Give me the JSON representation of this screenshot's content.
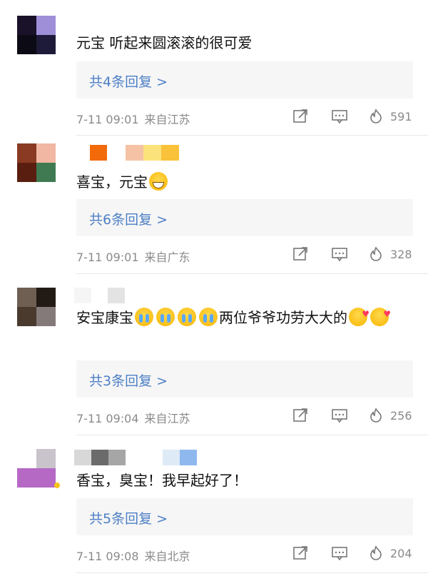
{
  "colors": {
    "link": "#4d7fc6",
    "meta": "#8a8a8a",
    "reply_bg": "#f6f6f6"
  },
  "comments": [
    {
      "text": "元宝 听起来圆滚滚的很可爱",
      "reply_label": "共4条回复 >",
      "time": "7-11 09:01",
      "source": "来自江苏",
      "likes": "591"
    },
    {
      "text": "喜宝，元宝",
      "reply_label": "共6条回复 >",
      "time": "7-11 09:01",
      "source": "来自广东",
      "likes": "328"
    },
    {
      "text_a": "安宝康宝",
      "text_b": "两位爷爷功劳大大的",
      "reply_label": "共3条回复 >",
      "time": "7-11 09:04",
      "source": "来自江苏",
      "likes": "256"
    },
    {
      "text": "香宝，臭宝！我早起好了！",
      "reply_label": "共5条回复 >",
      "time": "7-11 09:08",
      "source": "来自北京",
      "likes": "204"
    }
  ],
  "icons": {
    "share": "share-icon",
    "comment": "comment-icon",
    "like": "like-icon"
  }
}
